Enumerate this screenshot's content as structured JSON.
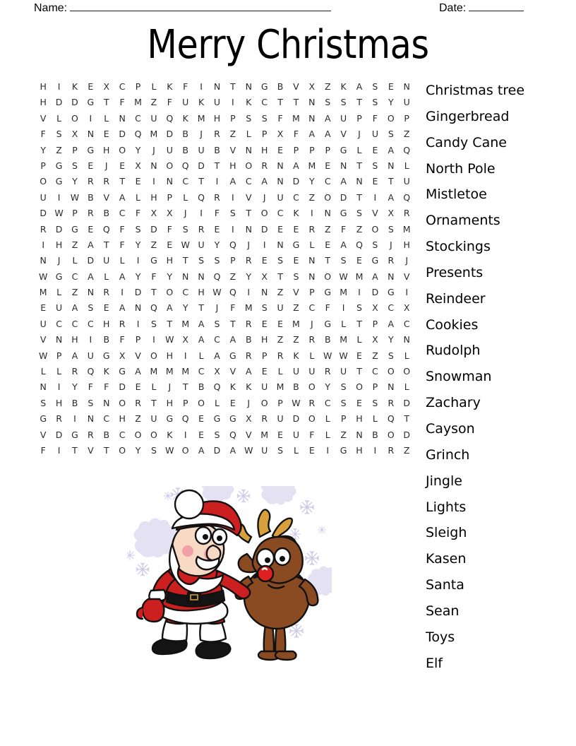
{
  "header": {
    "name_label": "Name:",
    "date_label": "Date:",
    "name_value": "",
    "date_value": ""
  },
  "title": "Merry Christmas",
  "grid": {
    "rows": 24,
    "cols": 24,
    "letters": [
      [
        "H",
        "I",
        "K",
        "E",
        "X",
        "C",
        "P",
        "L",
        "K",
        "F",
        "I",
        "N",
        "T",
        "N",
        "G",
        "B",
        "V",
        "X",
        "Z",
        "K",
        "A",
        "S",
        "E",
        "N"
      ],
      [
        "H",
        "D",
        "D",
        "G",
        "T",
        "F",
        "M",
        "Z",
        "F",
        "U",
        "K",
        "U",
        "I",
        "K",
        "C",
        "T",
        "T",
        "N",
        "S",
        "S",
        "T",
        "S",
        "Y",
        "U"
      ],
      [
        "V",
        "L",
        "O",
        "I",
        "L",
        "N",
        "C",
        "U",
        "Q",
        "K",
        "M",
        "H",
        "P",
        "S",
        "S",
        "F",
        "M",
        "N",
        "A",
        "U",
        "P",
        "F",
        "O",
        "P"
      ],
      [
        "F",
        "S",
        "X",
        "N",
        "E",
        "D",
        "Q",
        "M",
        "D",
        "B",
        "J",
        "R",
        "Z",
        "L",
        "P",
        "X",
        "F",
        "A",
        "A",
        "V",
        "J",
        "U",
        "S",
        "Z"
      ],
      [
        "Y",
        "Z",
        "P",
        "G",
        "H",
        "O",
        "Y",
        "J",
        "U",
        "B",
        "U",
        "B",
        "V",
        "N",
        "H",
        "E",
        "P",
        "P",
        "P",
        "G",
        "L",
        "E",
        "A",
        "Q"
      ],
      [
        "P",
        "G",
        "S",
        "E",
        "J",
        "E",
        "X",
        "N",
        "O",
        "Q",
        "D",
        "T",
        "H",
        "O",
        "R",
        "N",
        "A",
        "M",
        "E",
        "N",
        "T",
        "S",
        "N",
        "L"
      ],
      [
        "O",
        "G",
        "Y",
        "R",
        "R",
        "T",
        "E",
        "I",
        "N",
        "C",
        "T",
        "I",
        "A",
        "C",
        "A",
        "N",
        "D",
        "Y",
        "C",
        "A",
        "N",
        "E",
        "T",
        "U"
      ],
      [
        "U",
        "I",
        "W",
        "B",
        "V",
        "A",
        "L",
        "H",
        "P",
        "L",
        "Q",
        "R",
        "I",
        "V",
        "J",
        "U",
        "C",
        "Z",
        "O",
        "D",
        "T",
        "I",
        "A",
        "Q"
      ],
      [
        "D",
        "W",
        "P",
        "R",
        "B",
        "C",
        "F",
        "X",
        "X",
        "J",
        "I",
        "F",
        "S",
        "T",
        "O",
        "C",
        "K",
        "I",
        "N",
        "G",
        "S",
        "V",
        "X",
        "R"
      ],
      [
        "R",
        "D",
        "G",
        "E",
        "Q",
        "F",
        "S",
        "D",
        "F",
        "S",
        "R",
        "E",
        "I",
        "N",
        "D",
        "E",
        "E",
        "R",
        "Z",
        "F",
        "Z",
        "O",
        "S",
        "M"
      ],
      [
        "I",
        "H",
        "Z",
        "A",
        "T",
        "F",
        "Y",
        "Z",
        "E",
        "W",
        "U",
        "Y",
        "Q",
        "J",
        "I",
        "N",
        "G",
        "L",
        "E",
        "A",
        "Q",
        "S",
        "J",
        "H"
      ],
      [
        "N",
        "J",
        "L",
        "D",
        "U",
        "L",
        "I",
        "G",
        "H",
        "T",
        "S",
        "S",
        "P",
        "R",
        "E",
        "S",
        "E",
        "N",
        "T",
        "S",
        "E",
        "G",
        "R",
        "J"
      ],
      [
        "W",
        "G",
        "C",
        "A",
        "L",
        "A",
        "Y",
        "F",
        "Y",
        "N",
        "N",
        "Q",
        "Z",
        "Y",
        "X",
        "T",
        "S",
        "N",
        "O",
        "W",
        "M",
        "A",
        "N",
        "V"
      ],
      [
        "M",
        "L",
        "Z",
        "N",
        "R",
        "I",
        "D",
        "T",
        "O",
        "C",
        "H",
        "W",
        "Q",
        "I",
        "N",
        "Z",
        "V",
        "P",
        "G",
        "M",
        "I",
        "D",
        "G",
        "I"
      ],
      [
        "E",
        "U",
        "A",
        "S",
        "E",
        "A",
        "N",
        "Q",
        "A",
        "Y",
        "T",
        "J",
        "F",
        "M",
        "S",
        "U",
        "Z",
        "C",
        "F",
        "I",
        "S",
        "X",
        "C",
        "X"
      ],
      [
        "U",
        "C",
        "C",
        "C",
        "H",
        "R",
        "I",
        "S",
        "T",
        "M",
        "A",
        "S",
        "T",
        "R",
        "E",
        "E",
        "M",
        "J",
        "G",
        "L",
        "T",
        "P",
        "A",
        "C"
      ],
      [
        "V",
        "N",
        "H",
        "I",
        "B",
        "F",
        "P",
        "I",
        "W",
        "X",
        "A",
        "C",
        "A",
        "B",
        "H",
        "Z",
        "Z",
        "R",
        "B",
        "M",
        "L",
        "X",
        "Y",
        "N"
      ],
      [
        "W",
        "P",
        "A",
        "U",
        "G",
        "X",
        "V",
        "O",
        "H",
        "I",
        "L",
        "A",
        "G",
        "R",
        "P",
        "R",
        "K",
        "L",
        "W",
        "W",
        "E",
        "Z",
        "S",
        "L"
      ],
      [
        "L",
        "L",
        "R",
        "Q",
        "K",
        "G",
        "A",
        "M",
        "M",
        "M",
        "C",
        "X",
        "V",
        "A",
        "E",
        "L",
        "U",
        "U",
        "R",
        "U",
        "T",
        "C",
        "O",
        "O"
      ],
      [
        "N",
        "I",
        "Y",
        "F",
        "F",
        "D",
        "E",
        "L",
        "J",
        "T",
        "B",
        "Q",
        "K",
        "K",
        "U",
        "M",
        "B",
        "O",
        "Y",
        "S",
        "O",
        "P",
        "N",
        "L"
      ],
      [
        "S",
        "H",
        "B",
        "S",
        "N",
        "O",
        "R",
        "T",
        "H",
        "P",
        "O",
        "L",
        "E",
        "J",
        "O",
        "P",
        "W",
        "R",
        "C",
        "S",
        "E",
        "S",
        "R",
        "D"
      ],
      [
        "G",
        "R",
        "I",
        "N",
        "C",
        "H",
        "Z",
        "U",
        "G",
        "Q",
        "E",
        "G",
        "G",
        "X",
        "R",
        "U",
        "D",
        "O",
        "L",
        "P",
        "H",
        "L",
        "Q",
        "T"
      ],
      [
        "V",
        "D",
        "G",
        "R",
        "B",
        "C",
        "O",
        "O",
        "K",
        "I",
        "E",
        "S",
        "Q",
        "V",
        "M",
        "E",
        "U",
        "F",
        "L",
        "Z",
        "N",
        "B",
        "O",
        "D"
      ],
      [
        "F",
        "I",
        "T",
        "V",
        "T",
        "O",
        "Y",
        "S",
        "W",
        "O",
        "A",
        "D",
        "A",
        "W",
        "U",
        "S",
        "L",
        "E",
        "I",
        "G",
        "H",
        "I",
        "R",
        "Z"
      ]
    ]
  },
  "word_list": [
    "Christmas tree",
    "Gingerbread",
    "Candy Cane",
    "North Pole",
    "Mistletoe",
    "Ornaments",
    "Stockings",
    "Presents",
    "Reindeer",
    "Cookies",
    "Rudolph",
    "Snowman",
    "Zachary",
    "Cayson",
    "Grinch",
    "Jingle",
    "Lights",
    "Sleigh",
    "Kasen",
    "Santa",
    "Sean",
    "Toys",
    "Elf"
  ],
  "illustration": {
    "name": "santa-and-reindeer-illustration",
    "colors": {
      "santa_suit": "#cc1f1f",
      "santa_suit_dark": "#a01414",
      "fur_white": "#ffffff",
      "skin": "#f7d9c4",
      "cheek": "#f0a0a8",
      "reindeer_body": "#8a4b22",
      "reindeer_body_light": "#a55c2c",
      "antler": "#d8a03c",
      "nose_red": "#e02020",
      "boot_black": "#141414",
      "snowflake": "#ccc8e8",
      "snow_blob": "#e4e1f3"
    }
  }
}
